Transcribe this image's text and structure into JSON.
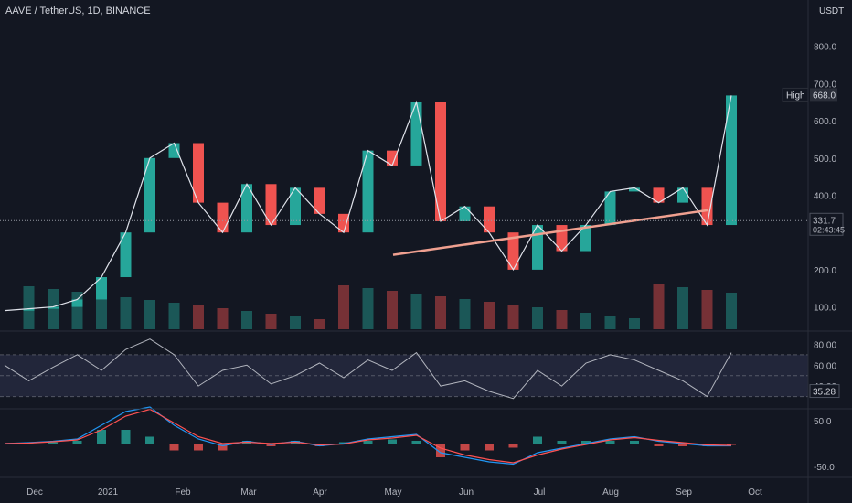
{
  "header": {
    "title": "AAVE / TetherUS, 1D, BINANCE"
  },
  "axis": {
    "currency": "USDT",
    "price_ticks": [
      "800.0",
      "700.0",
      "600.0",
      "500.0",
      "400.0",
      "200.0",
      "100.0"
    ],
    "rsi_ticks": [
      "80.00",
      "60.00",
      "40.00"
    ],
    "macd_ticks": [
      "50.0",
      "-50.0"
    ],
    "months": [
      "Dec",
      "2021",
      "Feb",
      "Mar",
      "Apr",
      "May",
      "Jun",
      "Jul",
      "Aug",
      "Sep",
      "Oct"
    ]
  },
  "labels": {
    "high_label": "High",
    "high_value": "668.0",
    "last_price": "331.7",
    "countdown": "02:43:45",
    "rsi_value": "35.28"
  },
  "colors": {
    "bg": "#131722",
    "up": "#26a69a",
    "down": "#ef5350",
    "trend": "#f0a090",
    "white": "#e0e3eb",
    "rsi_band": "#2a2e45",
    "macd": "#2196f3",
    "signal": "#ff5252"
  },
  "chart_data": [
    {
      "type": "line",
      "panel": "price",
      "title": "AAVE / TetherUS, 1D, BINANCE",
      "ylabel": "USDT",
      "ylim": [
        40,
        900
      ],
      "x": [
        "Dec",
        "2021",
        "Feb",
        "Mar",
        "Apr",
        "May",
        "Jun",
        "Jul",
        "Aug",
        "Sep",
        "Oct"
      ],
      "series": [
        {
          "values": [
            90,
            95,
            100,
            120,
            180,
            300,
            500,
            540,
            380,
            300,
            430,
            320,
            420,
            350,
            300,
            520,
            480,
            650,
            330,
            370,
            300,
            200,
            320,
            250,
            320,
            410,
            420,
            380,
            420,
            320,
            668
          ]
        }
      ],
      "high": 668.0,
      "last": 331.7
    },
    {
      "type": "line",
      "panel": "rsi",
      "ylim": [
        20,
        90
      ],
      "series": [
        {
          "values": [
            60,
            45,
            58,
            70,
            55,
            75,
            85,
            70,
            40,
            55,
            60,
            42,
            50,
            62,
            48,
            65,
            55,
            72,
            40,
            45,
            35,
            28,
            55,
            40,
            62,
            70,
            65,
            55,
            45,
            30,
            72
          ]
        }
      ],
      "last": 35.28
    },
    {
      "type": "line",
      "panel": "macd",
      "ylim": [
        -70,
        70
      ],
      "series": [
        {
          "values": [
            0,
            2,
            5,
            10,
            40,
            70,
            80,
            40,
            10,
            -5,
            5,
            -2,
            5,
            -5,
            0,
            10,
            15,
            20,
            -20,
            -30,
            -40,
            -45,
            -20,
            -10,
            0,
            10,
            15,
            5,
            0,
            -5,
            -5
          ]
        },
        {
          "values": [
            0,
            1,
            4,
            8,
            30,
            60,
            75,
            45,
            15,
            0,
            3,
            0,
            3,
            -3,
            -1,
            8,
            12,
            18,
            -10,
            -25,
            -35,
            -42,
            -25,
            -12,
            -2,
            8,
            13,
            7,
            2,
            -3,
            -4
          ]
        }
      ]
    }
  ]
}
